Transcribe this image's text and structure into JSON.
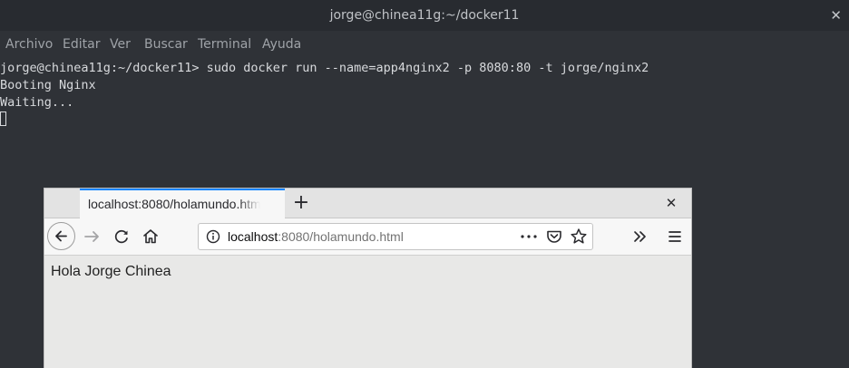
{
  "terminal": {
    "title": "jorge@chinea11g:~/docker11",
    "close_glyph": "✕",
    "menu": [
      "Archivo",
      "Editar",
      "Ver",
      "Buscar",
      "Terminal",
      "Ayuda"
    ],
    "lines": [
      "jorge@chinea11g:~/docker11> sudo docker run --name=app4nginx2 -p 8080:80 -t jorge/nginx2",
      "Booting Nginx",
      "Waiting..."
    ]
  },
  "browser": {
    "tab_title": "localhost:8080/holamundo.html",
    "new_tab_glyph": "+",
    "close_glyph": "✕",
    "url_host": "localhost",
    "url_rest": ":8080/holamundo.html",
    "page_text": "Hola Jorge Chinea",
    "icons": [
      "back-icon",
      "forward-icon",
      "reload-icon",
      "home-icon",
      "info-icon",
      "more-actions-icon",
      "pocket-icon",
      "bookmark-star-icon",
      "overflow-chevrons-icon",
      "hamburger-menu-icon"
    ]
  },
  "colors": {
    "terminal_bg": "#2f3237",
    "terminal_text": "#d8dadd",
    "tab_accent": "#0a84ff"
  }
}
